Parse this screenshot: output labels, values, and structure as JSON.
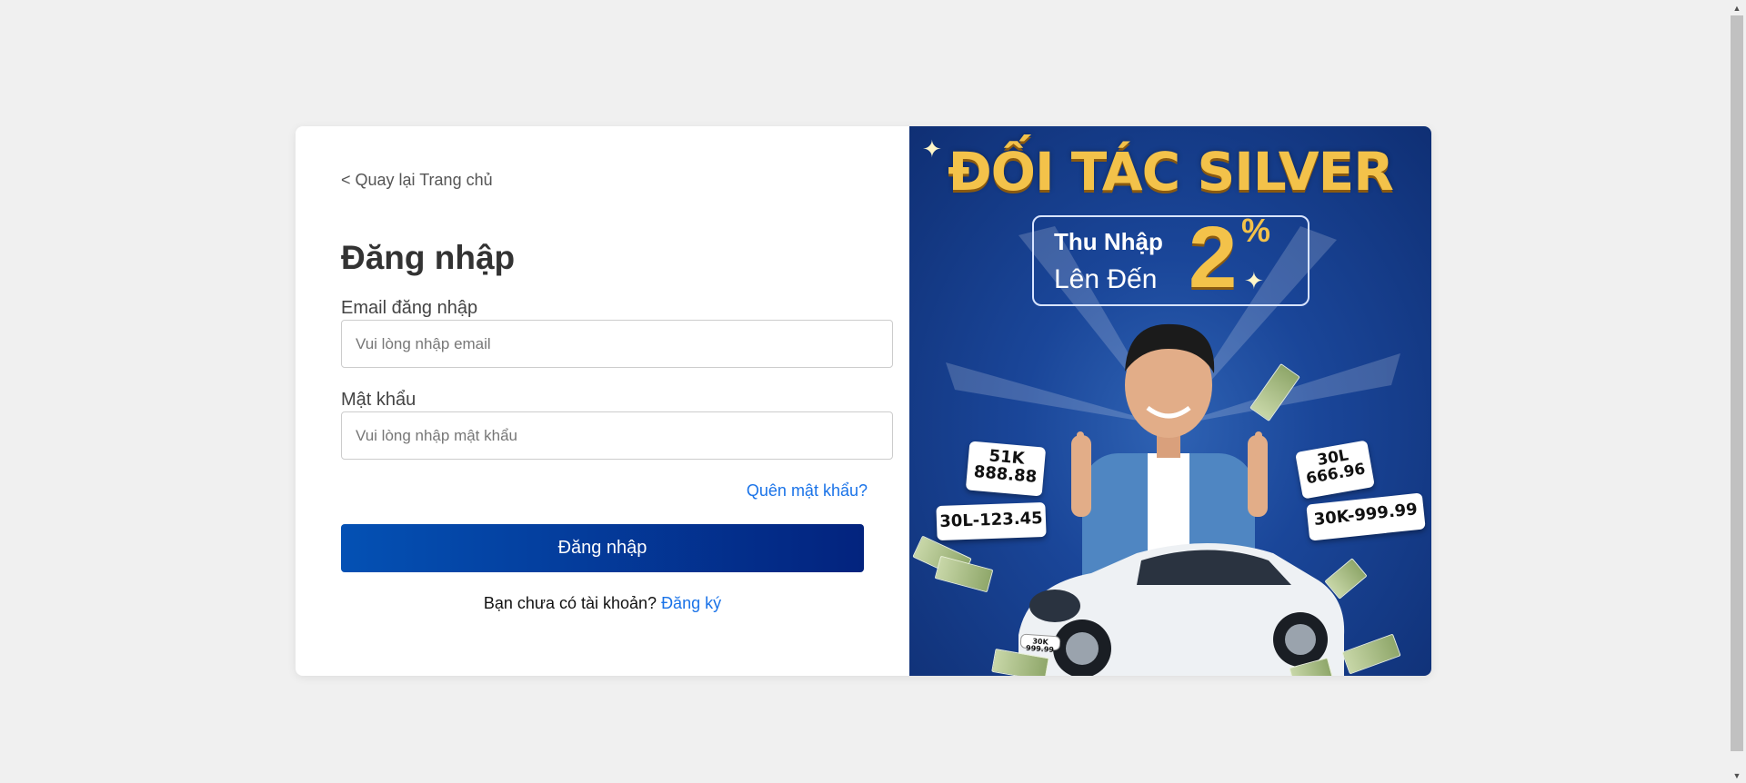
{
  "nav": {
    "back_label": "< Quay lại Trang chủ"
  },
  "login": {
    "title": "Đăng nhập",
    "email_label": "Email đăng nhập",
    "email_placeholder": "Vui lòng nhập email",
    "email_value": "",
    "password_label": "Mật khẩu",
    "password_placeholder": "Vui lòng nhập mật khẩu",
    "password_value": "",
    "forgot_label": "Quên mật khẩu?",
    "submit_label": "Đăng nhập",
    "signup_prompt": "Bạn chưa có tài khoản? ",
    "signup_label": "Đăng ký"
  },
  "banner": {
    "title": "ĐỐI TÁC SILVER",
    "income_line1": "Thu Nhập",
    "income_line2": "Lên Đến",
    "income_value": "2",
    "income_unit": "%",
    "plates": [
      "51K\n888.88",
      "30L-123.45",
      "30L\n666.96",
      "30K-999.99"
    ],
    "car_plate": "30K 999.99"
  },
  "colors": {
    "primary_gradient_start": "#0451b4",
    "primary_gradient_end": "#03237e",
    "link": "#1a73e8",
    "banner_gold": "#f3c24a",
    "banner_blue": "#1a4699",
    "page_background": "#f0f0f0"
  }
}
